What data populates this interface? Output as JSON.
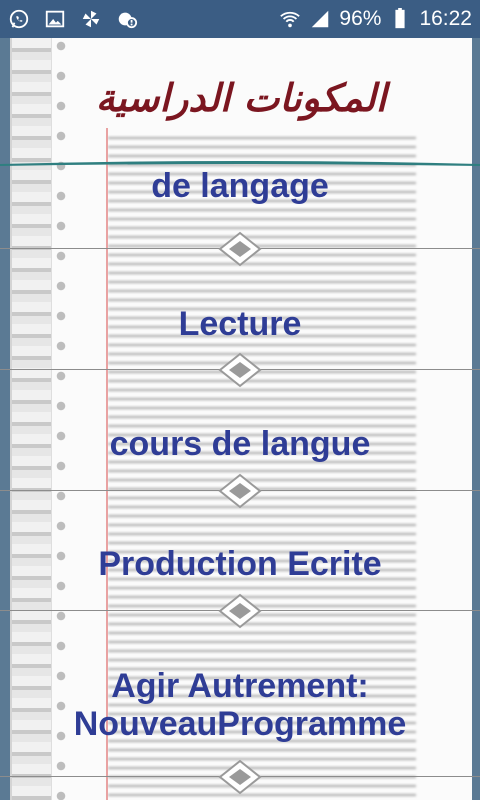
{
  "status_bar": {
    "battery": "96%",
    "time": "16:22"
  },
  "header": {
    "title": "المكونات الدراسية"
  },
  "list": {
    "items": [
      {
        "label": "de langage"
      },
      {
        "label": "Lecture"
      },
      {
        "label": "cours de langue"
      },
      {
        "label": "Production Ecrite"
      },
      {
        "label": "Agir Autrement: NouveauProgramme"
      }
    ]
  },
  "colors": {
    "status_bar": "#3b5d84",
    "item_text": "#2f3d96",
    "title_text": "#7b1620",
    "divider": "#2f7f80"
  }
}
